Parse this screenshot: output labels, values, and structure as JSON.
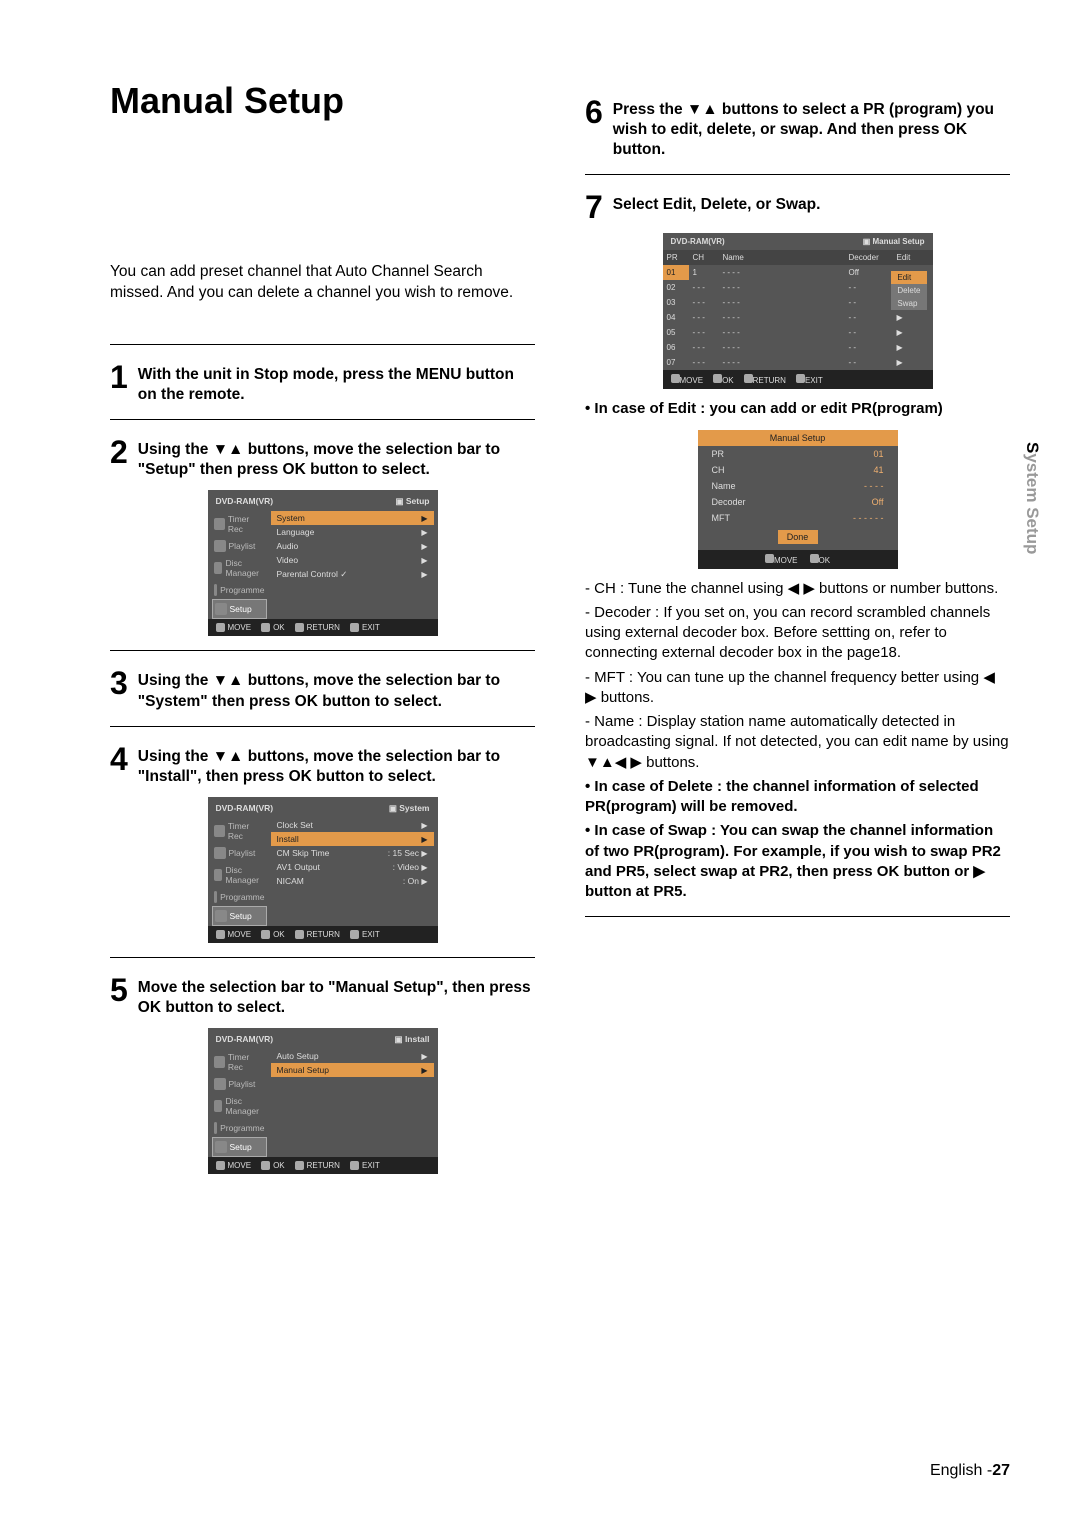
{
  "title": "Manual Setup",
  "intro": "You can add preset channel that Auto Channel Search missed. And you can delete a channel you wish to remove.",
  "sidetab_bold": "S",
  "sidetab_rest": "ystem Setup",
  "footer_lang": "English -",
  "footer_page": "27",
  "steps": {
    "s1": {
      "n": "1",
      "t": "With the unit in Stop mode, press the MENU button on the remote."
    },
    "s2": {
      "n": "2",
      "t": "Using the ▼▲ buttons, move the selection bar to \"Setup\" then press OK button to select."
    },
    "s3": {
      "n": "3",
      "t": "Using the ▼▲ buttons, move the selection bar to \"System\" then press OK button to select."
    },
    "s4": {
      "n": "4",
      "t": "Using the ▼▲ buttons, move the selection bar to \"Install\", then press OK button to select."
    },
    "s5": {
      "n": "5",
      "t": "Move the selection bar to \"Manual Setup\", then press OK button to select."
    },
    "s6": {
      "n": "6",
      "t": "Press the ▼▲ buttons to select a PR (program) you wish to edit, delete, or swap. And then press OK button."
    },
    "s7": {
      "n": "7",
      "t": "Select Edit, Delete, or Swap."
    }
  },
  "osd": {
    "disc": "DVD-RAM(VR)",
    "side": [
      "Timer Rec",
      "Playlist",
      "Disc Manager",
      "Programme",
      "Setup"
    ],
    "foot": {
      "move": "MOVE",
      "ok": "OK",
      "return": "RETURN",
      "exit": "EXIT"
    }
  },
  "setup_screen": {
    "crumb": "Setup",
    "items": [
      "System",
      "Language",
      "Audio",
      "Video",
      "Parental Control  ✓"
    ]
  },
  "system_screen": {
    "crumb": "System",
    "rows": [
      {
        "l": "Clock Set",
        "v": ""
      },
      {
        "l": "Install",
        "v": ""
      },
      {
        "l": "CM Skip Time",
        "v": ": 15 Sec"
      },
      {
        "l": "AV1 Output",
        "v": ": Video"
      },
      {
        "l": "NICAM",
        "v": ": On"
      }
    ]
  },
  "install_screen": {
    "crumb": "Install",
    "items": [
      "Auto Setup",
      "Manual Setup"
    ]
  },
  "table_screen": {
    "crumb": "Manual Setup",
    "hdr": {
      "pr": "PR",
      "ch": "CH",
      "name": "Name",
      "dec": "Decoder",
      "edit": "Edit"
    },
    "rows": [
      {
        "pr": "01",
        "ch": "1",
        "name": "- - - -",
        "dec": "Off",
        "sel": true,
        "edit": "Edit"
      },
      {
        "pr": "02",
        "ch": "- - -",
        "name": "- - - -",
        "dec": "- -",
        "edit": "Delete"
      },
      {
        "pr": "03",
        "ch": "- - -",
        "name": "- - - -",
        "dec": "- -",
        "edit": "Swap"
      },
      {
        "pr": "04",
        "ch": "- - -",
        "name": "- - - -",
        "dec": "- -"
      },
      {
        "pr": "05",
        "ch": "- - -",
        "name": "- - - -",
        "dec": "- -"
      },
      {
        "pr": "06",
        "ch": "- - -",
        "name": "- - - -",
        "dec": "- -"
      },
      {
        "pr": "07",
        "ch": "- - -",
        "name": "- - - -",
        "dec": "- -"
      }
    ]
  },
  "edit_screen": {
    "title": "Manual Setup",
    "rows": [
      {
        "l": "PR",
        "v": "01"
      },
      {
        "l": "CH",
        "v": "41"
      },
      {
        "l": "Name",
        "v": "- - - -"
      },
      {
        "l": "Decoder",
        "v": "Off"
      },
      {
        "l": "MFT",
        "v": "- - -  - - -"
      }
    ],
    "done": "Done"
  },
  "notes": {
    "edit_hdr": "• In case of Edit : you can add or edit PR(program)",
    "ch": "- CH : Tune the channel using ◀ ▶ buttons or number buttons.",
    "decoder": "- Decoder : If you set on, you can record scrambled channels using external decoder box. Before settting on, refer to connecting external decoder box in the page18.",
    "mft": "- MFT : You can tune up the channel frequency better using ◀ ▶ buttons.",
    "name": "- Name : Display station name automatically detected in broadcasting signal. If not detected, you can edit name by using ▼▲◀ ▶ buttons.",
    "delete": "• In case of Delete : the channel information of selected PR(program) will be removed.",
    "swap": "• In case of  Swap : You can swap the channel information of two PR(program).  For example, if you wish to swap PR2 and PR5,  select swap at PR2, then press OK button or ▶ button at PR5."
  }
}
